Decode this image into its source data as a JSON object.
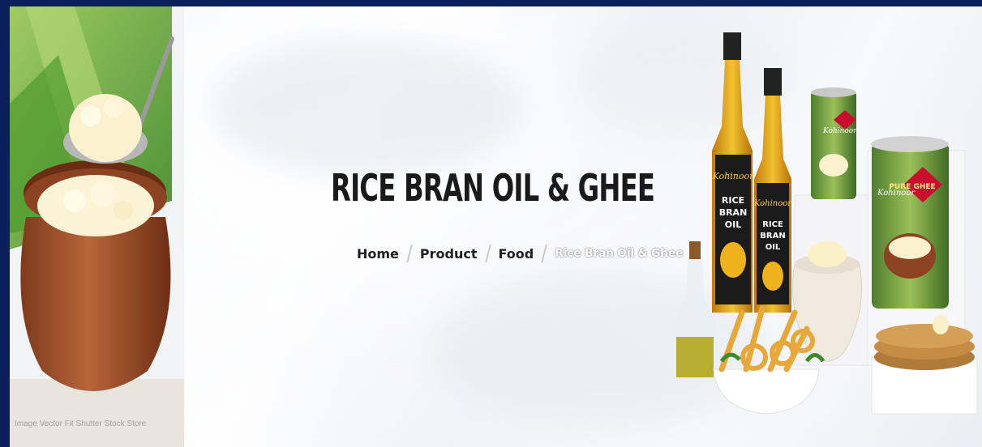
{
  "banner": {
    "title": "RICE BRAN OIL & GHEE",
    "watermark": "Image Vector Fit Shutter Stock Store"
  },
  "breadcrumb": {
    "items": [
      "Home",
      "Product",
      "Food"
    ],
    "current": "Rice Bran Oil & Ghee"
  },
  "products": {
    "brand": "Kohinoor",
    "bottle_label": "RICE BRAN OIL",
    "can_label": "PURE GHEE"
  },
  "colors": {
    "frame": "#0b1f5c",
    "title": "#1a1a1a",
    "pot": "#a0502c",
    "label_red": "#c8102e",
    "oil": "#e3a51a"
  }
}
